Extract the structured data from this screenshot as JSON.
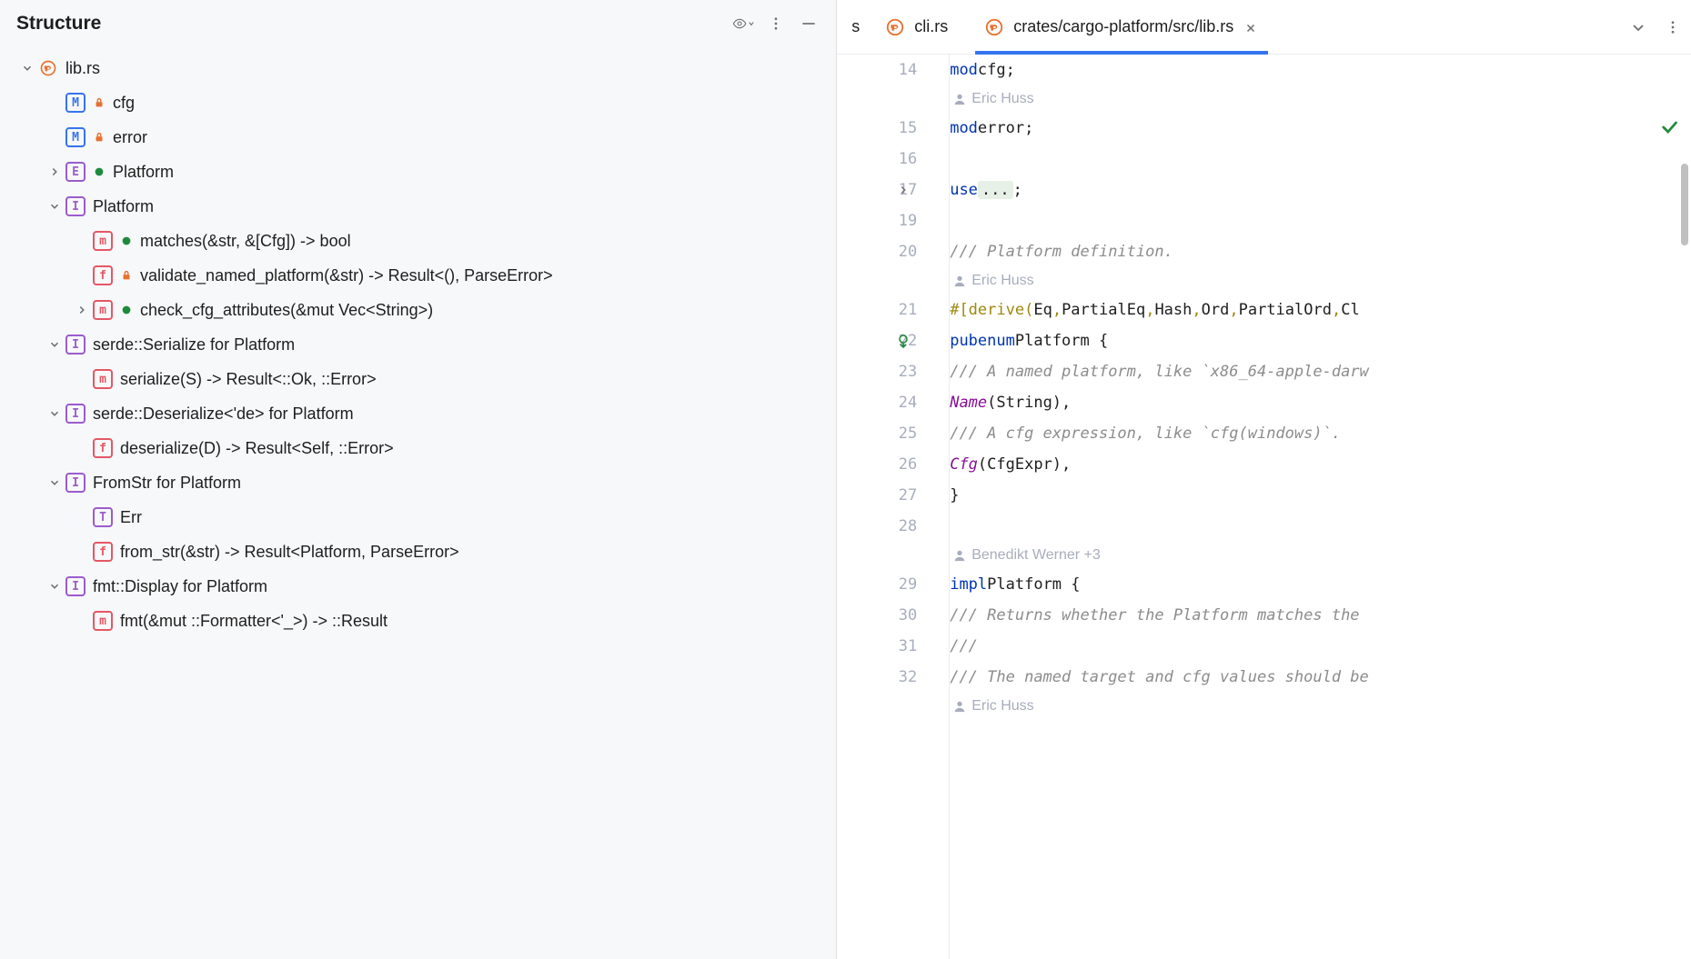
{
  "panel": {
    "title": "Structure"
  },
  "tree": [
    {
      "depth": 0,
      "chev": "down",
      "icon": "rust",
      "label": "lib.rs"
    },
    {
      "depth": 1,
      "chev": "",
      "icon": "M",
      "vis": "lock",
      "label": "cfg"
    },
    {
      "depth": 1,
      "chev": "",
      "icon": "M",
      "vis": "lock",
      "label": "error"
    },
    {
      "depth": 1,
      "chev": "right",
      "icon": "E",
      "vis": "pub",
      "label": "Platform"
    },
    {
      "depth": 1,
      "chev": "down",
      "icon": "I",
      "label": "Platform"
    },
    {
      "depth": 2,
      "chev": "",
      "icon": "m",
      "vis": "pub",
      "label": "matches(&str, &[Cfg]) -> bool"
    },
    {
      "depth": 2,
      "chev": "",
      "icon": "f",
      "vis": "lock",
      "label": "validate_named_platform(&str) -> Result<(), ParseError>"
    },
    {
      "depth": 2,
      "chev": "right",
      "icon": "m",
      "vis": "pub",
      "label": "check_cfg_attributes(&mut Vec<String>)"
    },
    {
      "depth": 1,
      "chev": "down",
      "icon": "I",
      "label": "serde::Serialize for Platform"
    },
    {
      "depth": 2,
      "chev": "",
      "icon": "m",
      "label": "serialize(S) -> Result<::Ok, ::Error>"
    },
    {
      "depth": 1,
      "chev": "down",
      "icon": "I",
      "label": "serde::Deserialize<'de> for Platform"
    },
    {
      "depth": 2,
      "chev": "",
      "icon": "f",
      "label": "deserialize(D) -> Result<Self, ::Error>"
    },
    {
      "depth": 1,
      "chev": "down",
      "icon": "I",
      "label": "FromStr for Platform"
    },
    {
      "depth": 2,
      "chev": "",
      "icon": "T",
      "label": "Err"
    },
    {
      "depth": 2,
      "chev": "",
      "icon": "f",
      "label": "from_str(&str) -> Result<Platform, ParseError>"
    },
    {
      "depth": 1,
      "chev": "down",
      "icon": "I",
      "label": "fmt::Display for Platform"
    },
    {
      "depth": 2,
      "chev": "",
      "icon": "m",
      "label": "fmt(&mut ::Formatter<'_>) -> ::Result"
    }
  ],
  "tabs": {
    "partial": "s",
    "items": [
      {
        "label": "cli.rs",
        "active": false
      },
      {
        "label": "crates/cargo-platform/src/lib.rs",
        "active": true
      }
    ]
  },
  "editor": {
    "lines": [
      {
        "n": 14,
        "type": "code",
        "tokens": [
          [
            "kw",
            "mod"
          ],
          [
            "",
            " cfg;"
          ]
        ]
      },
      {
        "type": "author",
        "text": "Eric Huss"
      },
      {
        "n": 15,
        "type": "code",
        "tokens": [
          [
            "kw",
            "mod"
          ],
          [
            "",
            " error;"
          ]
        ]
      },
      {
        "n": 16,
        "type": "code",
        "tokens": []
      },
      {
        "n": 17,
        "type": "code",
        "fold": true,
        "tokens": [
          [
            "kw",
            "use"
          ],
          [
            "",
            " "
          ],
          [
            "fold",
            "..."
          ],
          [
            "",
            ";"
          ]
        ]
      },
      {
        "n": 19,
        "type": "code",
        "tokens": []
      },
      {
        "n": 20,
        "type": "code",
        "tokens": [
          [
            "comment",
            "/// Platform definition."
          ]
        ]
      },
      {
        "type": "author",
        "text": "Eric Huss"
      },
      {
        "n": 21,
        "type": "code",
        "tokens": [
          [
            "meta",
            "#[derive("
          ],
          [
            "type",
            "Eq"
          ],
          [
            "meta",
            ", "
          ],
          [
            "type",
            "PartialEq"
          ],
          [
            "meta",
            ", "
          ],
          [
            "type",
            "Hash"
          ],
          [
            "meta",
            ", "
          ],
          [
            "type",
            "Ord"
          ],
          [
            "meta",
            ", "
          ],
          [
            "type",
            "PartialOrd"
          ],
          [
            "meta",
            ", "
          ],
          [
            "type",
            "Cl"
          ]
        ]
      },
      {
        "n": 22,
        "type": "code",
        "mark": "impl",
        "tokens": [
          [
            "kw",
            "pub"
          ],
          [
            "",
            " "
          ],
          [
            "kw",
            "enum"
          ],
          [
            "",
            " Platform {"
          ]
        ]
      },
      {
        "n": 23,
        "type": "code",
        "tokens": [
          [
            "",
            "    "
          ],
          [
            "comment",
            "/// A named platform, like `x86_64-apple-darw"
          ]
        ]
      },
      {
        "n": 24,
        "type": "code",
        "tokens": [
          [
            "",
            "    "
          ],
          [
            "fn",
            "Name"
          ],
          [
            "",
            "(String),"
          ]
        ]
      },
      {
        "n": 25,
        "type": "code",
        "tokens": [
          [
            "",
            "    "
          ],
          [
            "comment",
            "/// A cfg expression, like `cfg(windows)`."
          ]
        ]
      },
      {
        "n": 26,
        "type": "code",
        "tokens": [
          [
            "",
            "    "
          ],
          [
            "fn",
            "Cfg"
          ],
          [
            "",
            "(CfgExpr),"
          ]
        ]
      },
      {
        "n": 27,
        "type": "code",
        "tokens": [
          [
            "",
            "}"
          ]
        ]
      },
      {
        "n": 28,
        "type": "code",
        "tokens": []
      },
      {
        "type": "author",
        "text": "Benedikt Werner +3"
      },
      {
        "n": 29,
        "type": "code",
        "tokens": [
          [
            "kw",
            "impl"
          ],
          [
            "",
            " Platform {"
          ]
        ]
      },
      {
        "n": 30,
        "type": "code",
        "tokens": [
          [
            "",
            "    "
          ],
          [
            "comment",
            "/// Returns whether the Platform matches the"
          ]
        ]
      },
      {
        "n": 31,
        "type": "code",
        "tokens": [
          [
            "",
            "    "
          ],
          [
            "comment",
            "///"
          ]
        ]
      },
      {
        "n": 32,
        "type": "code",
        "tokens": [
          [
            "",
            "    "
          ],
          [
            "comment",
            "/// The named target and cfg values should be"
          ]
        ]
      },
      {
        "type": "author",
        "text": "Eric Huss"
      }
    ]
  }
}
